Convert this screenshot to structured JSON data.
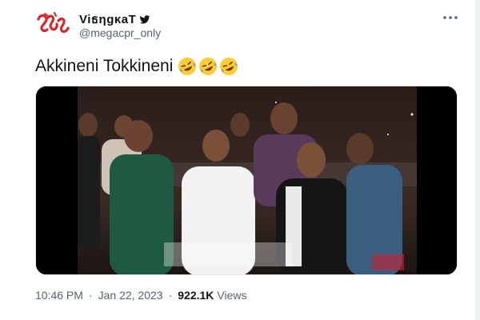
{
  "author": {
    "display_name": "ViธηgκaT",
    "handle": "@megacpr_only",
    "verified_badge_icon": "twitter-bird-icon",
    "avatar_icon": "logo-avatar"
  },
  "tweet": {
    "text": "Akkineni Tokkineni",
    "emojis": [
      "rolling-on-floor-laughing-emoji",
      "rolling-on-floor-laughing-emoji",
      "rolling-on-floor-laughing-emoji"
    ]
  },
  "media": {
    "type": "video-thumbnail"
  },
  "meta": {
    "time": "10:46 PM",
    "separator": "·",
    "date": "Jan 22, 2023",
    "views_count": "922.1K",
    "views_label": "Views"
  },
  "colors": {
    "text_primary": "#0f1419",
    "text_secondary": "#536471",
    "twitter_blue": "#1d9bf0",
    "avatar_red": "#d8292a"
  }
}
